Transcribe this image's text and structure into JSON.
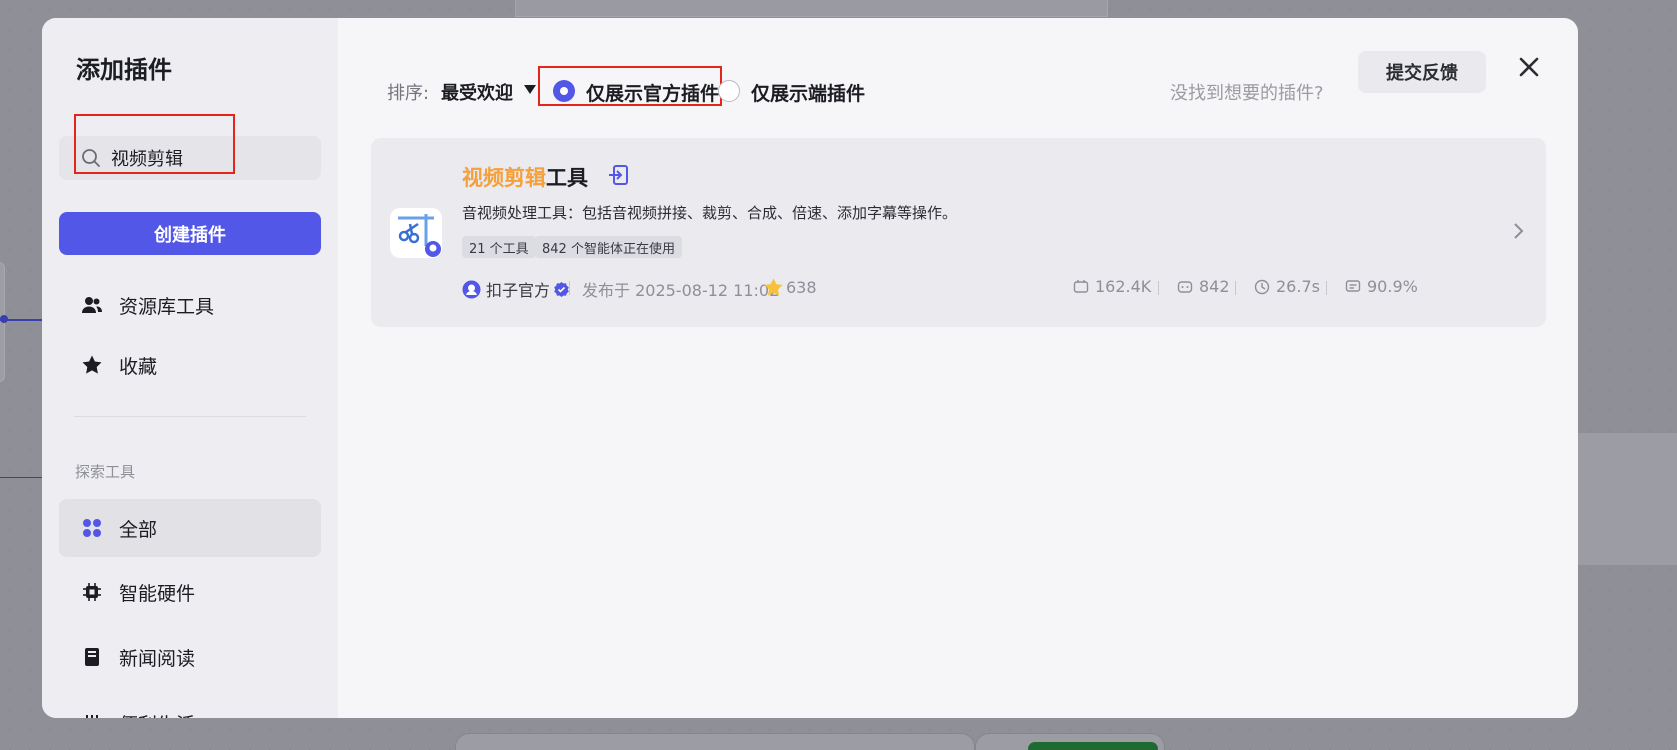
{
  "modal": {
    "title": "添加插件"
  },
  "sidebar": {
    "search": {
      "value": "视频剪辑",
      "icon": "search-icon"
    },
    "create_button": "创建插件",
    "items": [
      {
        "label": "资源库工具",
        "icon": "users-icon"
      },
      {
        "label": "收藏",
        "icon": "star-icon"
      }
    ],
    "section_label": "探索工具",
    "categories": [
      {
        "label": "全部",
        "icon": "grid-icon",
        "active": true
      },
      {
        "label": "智能硬件",
        "icon": "chip-icon"
      },
      {
        "label": "新闻阅读",
        "icon": "book-icon"
      },
      {
        "label": "便利生活",
        "icon": "life-icon"
      }
    ]
  },
  "toolbar": {
    "sort_label": "排序:",
    "sort_value": "最受欢迎",
    "filter_official": "仅展示官方插件",
    "filter_edge": "仅展示端插件",
    "official_selected": true,
    "hint": "没找到想要的插件?",
    "feedback_button": "提交反馈"
  },
  "plugin": {
    "title_highlight": "视频剪辑",
    "title_rest": "工具",
    "description": "音视频处理工具：包括音视频拼接、裁剪、合成、倍速、添加字幕等操作。",
    "tags": [
      "21 个工具",
      "842 个智能体正在使用"
    ],
    "author": "扣子官方",
    "published": "发布于 2025-08-12 11:02",
    "favorites": "638",
    "stats": {
      "calls": "162.4K",
      "bots": "842",
      "latency": "26.7s",
      "success_rate": "90.9%"
    },
    "colors": {
      "highlight": "#f5a03a",
      "accent": "#5257e8"
    }
  }
}
